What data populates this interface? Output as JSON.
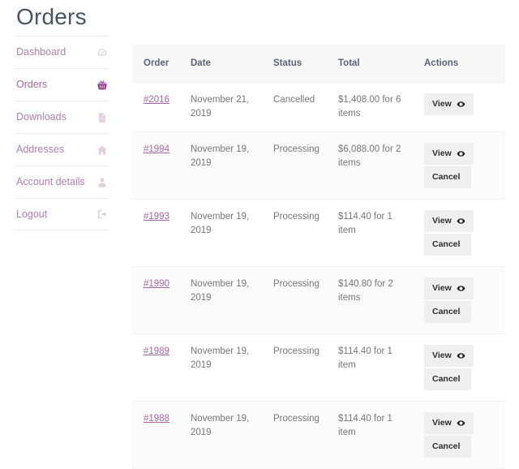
{
  "page": {
    "title": "Orders"
  },
  "sidebar": {
    "items": [
      {
        "label": "Dashboard",
        "icon": "dashboard-gauge-icon",
        "active": false
      },
      {
        "label": "Orders",
        "icon": "shopping-basket-icon",
        "active": true
      },
      {
        "label": "Downloads",
        "icon": "document-icon",
        "active": false
      },
      {
        "label": "Addresses",
        "icon": "home-icon",
        "active": false
      },
      {
        "label": "Account details",
        "icon": "user-icon",
        "active": false
      },
      {
        "label": "Logout",
        "icon": "logout-arrow-icon",
        "active": false
      }
    ]
  },
  "table": {
    "columns": [
      "Order",
      "Date",
      "Status",
      "Total",
      "Actions"
    ],
    "rows": [
      {
        "order": "#2016",
        "date": "November 21, 2019",
        "status": "Cancelled",
        "total": "$1,408.00 for 6 items",
        "actions": [
          "View"
        ]
      },
      {
        "order": "#1994",
        "date": "November 19, 2019",
        "status": "Processing",
        "total": "$6,088.00 for 2 items",
        "actions": [
          "View",
          "Cancel"
        ]
      },
      {
        "order": "#1993",
        "date": "November 19, 2019",
        "status": "Processing",
        "total": "$114.40 for 1 item",
        "actions": [
          "View",
          "Cancel"
        ]
      },
      {
        "order": "#1990",
        "date": "November 19, 2019",
        "status": "Processing",
        "total": "$140.80 for 2 items",
        "actions": [
          "View",
          "Cancel"
        ]
      },
      {
        "order": "#1989",
        "date": "November 19, 2019",
        "status": "Processing",
        "total": "$114.40 for 1 item",
        "actions": [
          "View",
          "Cancel"
        ]
      },
      {
        "order": "#1988",
        "date": "November 19, 2019",
        "status": "Processing",
        "total": "$114.40 for 1 item",
        "actions": [
          "View",
          "Cancel"
        ]
      }
    ]
  },
  "colors": {
    "title": "#4a5360",
    "link": "#a8679f",
    "nav_label": "#b07fae",
    "nav_icon": "#e2cfe0",
    "nav_icon_active": "#8e3e8c",
    "header_bg": "#f7f7f8",
    "button_bg": "#f0efef",
    "row_alt_bg": "#fcfbfc"
  }
}
